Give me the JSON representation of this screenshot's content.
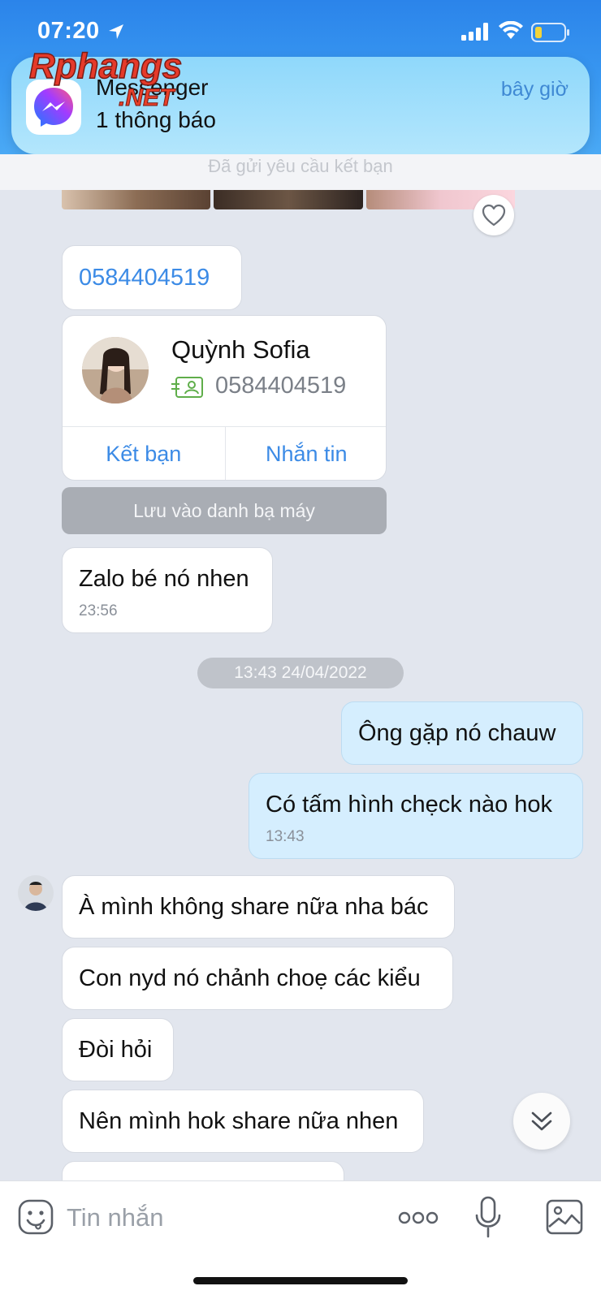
{
  "status_bar": {
    "time": "07:20"
  },
  "notification": {
    "app_name": "Messenger",
    "body": "1 thông báo",
    "time": "bây giờ",
    "watermark_top": "Rphangs",
    "watermark_bottom": ".NET"
  },
  "chat": {
    "header_partial": "Đã gửi yêu cầu kết bạn",
    "messages": [
      {
        "text": "0584404519"
      },
      {
        "text": "Zalo bé nó nhen",
        "time": "23:56"
      }
    ],
    "contact_card": {
      "name": "Quỳnh Sofia",
      "phone": "0584404519",
      "add_friend": "Kết bạn",
      "message": "Nhắn tin"
    },
    "save_contact": "Lưu vào danh bạ máy",
    "date_separator": "13:43 24/04/2022",
    "outgoing": [
      {
        "text": "Ông gặp nó chauw"
      },
      {
        "text": "Có tấm hình chẹck nào hok",
        "time": "13:43"
      }
    ],
    "incoming": [
      {
        "text": "À mình không share nữa nha bác"
      },
      {
        "text": "Con nyd nó chảnh choẹ các kiểu"
      },
      {
        "text": "Đòi hỏi"
      },
      {
        "text": "Nên mình hok share nữa nhen"
      }
    ]
  },
  "input_bar": {
    "placeholder": "Tin nhắn"
  },
  "colors": {
    "accent": "#3c8be6",
    "outgoing_bubble": "#d5eefe",
    "chat_bg": "#e2e6ee"
  }
}
